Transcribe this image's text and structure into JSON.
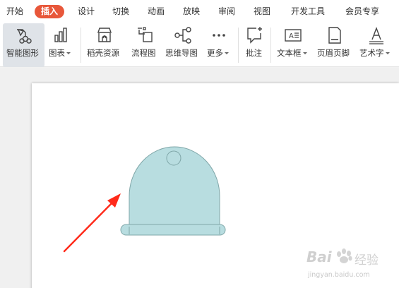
{
  "menu": {
    "items": [
      {
        "label": "开始"
      },
      {
        "label": "插入"
      },
      {
        "label": "设计"
      },
      {
        "label": "切换"
      },
      {
        "label": "动画"
      },
      {
        "label": "放映"
      },
      {
        "label": "审阅"
      },
      {
        "label": "视图"
      },
      {
        "label": "开发工具"
      },
      {
        "label": "会员专享"
      }
    ],
    "active_item": "插入"
  },
  "ribbon": {
    "smart_graphic": "智能图形",
    "chart": "图表",
    "docer_resources": "稻壳资源",
    "flowchart": "流程图",
    "mindmap": "思维导图",
    "more": "更多",
    "comment": "批注",
    "textbox": "文本框",
    "header_footer": "页眉页脚",
    "wordart": "艺术字"
  },
  "icons": {
    "smart_graphic": "smart-graphic-icon",
    "chart": "bar-chart-icon",
    "docer": "store-icon",
    "flowchart": "flowchart-icon",
    "mindmap": "mindmap-icon",
    "more": "ellipsis-icon",
    "comment": "comment-add-icon",
    "textbox": "textbox-icon",
    "header_footer": "document-icon",
    "wordart": "wordart-icon"
  },
  "colors": {
    "active_tab": "#e8573a",
    "shape_fill": "#b8dde0",
    "shape_stroke": "#7fa6a8",
    "arrow": "#ff2a1a"
  },
  "watermark": {
    "brand": "Bai",
    "brand_cn": "经验",
    "url": "jingyan.baidu.com"
  }
}
